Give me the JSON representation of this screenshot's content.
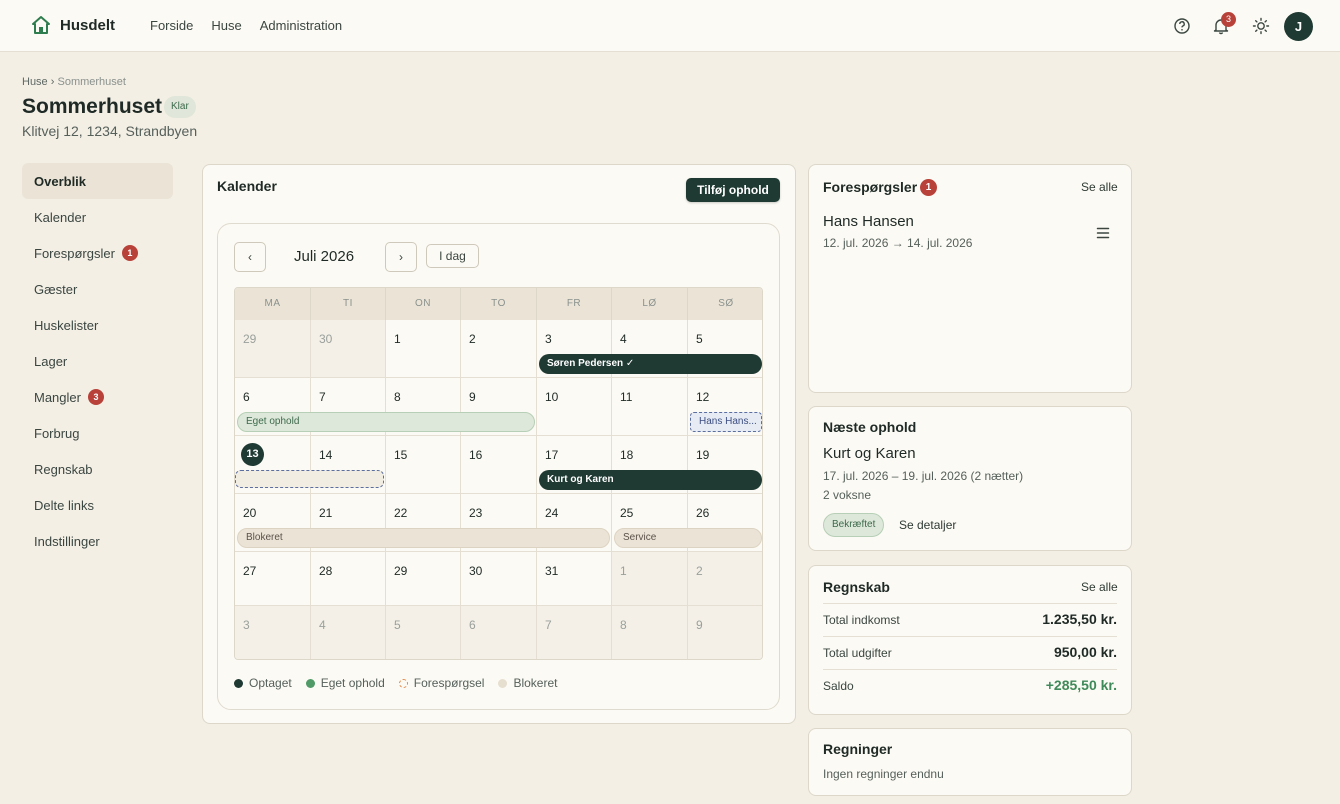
{
  "app": {
    "name": "Husdelt"
  },
  "nav": {
    "items": [
      "Forside",
      "Huse",
      "Administration"
    ]
  },
  "top": {
    "notifications_count": "3",
    "avatar_initial": "J"
  },
  "breadcrumb": {
    "parent": "Huse",
    "sep": "›",
    "current": "Sommerhuset"
  },
  "house": {
    "title": "Sommerhuset",
    "status": "Klar",
    "address": "Klitvej 12, 1234, Strandbyen"
  },
  "sidebar": {
    "items": [
      {
        "label": "Overblik",
        "badge": ""
      },
      {
        "label": "Kalender",
        "badge": ""
      },
      {
        "label": "Forespørgsler",
        "badge": "1"
      },
      {
        "label": "Gæster",
        "badge": ""
      },
      {
        "label": "Huskelister",
        "badge": ""
      },
      {
        "label": "Lager",
        "badge": ""
      },
      {
        "label": "Mangler",
        "badge": "3"
      },
      {
        "label": "Forbrug",
        "badge": ""
      },
      {
        "label": "Regnskab",
        "badge": ""
      },
      {
        "label": "Delte links",
        "badge": ""
      },
      {
        "label": "Indstillinger",
        "badge": ""
      }
    ]
  },
  "calendar": {
    "title": "Kalender",
    "add_label": "Tilføj ophold",
    "month_label": "Juli 2026",
    "prev": "‹",
    "next": "›",
    "today_label": "I dag",
    "weekdays": [
      "MA",
      "TI",
      "ON",
      "TO",
      "FR",
      "LØ",
      "SØ"
    ],
    "weeks": [
      [
        "29",
        "30",
        "1",
        "2",
        "3",
        "4",
        "5"
      ],
      [
        "6",
        "7",
        "8",
        "9",
        "10",
        "11",
        "12"
      ],
      [
        "13",
        "14",
        "15",
        "16",
        "17",
        "18",
        "19"
      ],
      [
        "20",
        "21",
        "22",
        "23",
        "24",
        "25",
        "26"
      ],
      [
        "27",
        "28",
        "29",
        "30",
        "31",
        "1",
        "2"
      ],
      [
        "3",
        "4",
        "5",
        "6",
        "7",
        "8",
        "9"
      ]
    ],
    "outside": [
      [
        0,
        0
      ],
      [
        0,
        1
      ],
      [
        4,
        5
      ],
      [
        4,
        6
      ],
      [
        5,
        0
      ],
      [
        5,
        1
      ],
      [
        5,
        2
      ],
      [
        5,
        3
      ],
      [
        5,
        4
      ],
      [
        5,
        5
      ],
      [
        5,
        6
      ]
    ],
    "today": [
      2,
      0
    ],
    "events": [
      {
        "label": "Søren Pedersen ✓",
        "type": "busy",
        "week": 0,
        "start": 4,
        "end": 6
      },
      {
        "label": "Eget ophold",
        "type": "own",
        "week": 1,
        "start": 0,
        "end": 3
      },
      {
        "label": "Hans Hans...",
        "type": "req",
        "week": 1,
        "start": 6,
        "end": 6
      },
      {
        "label": "",
        "type": "req-empty",
        "week": 2,
        "start": 0,
        "end": 1
      },
      {
        "label": "Kurt og Karen",
        "type": "busy",
        "week": 2,
        "start": 4,
        "end": 6
      },
      {
        "label": "Blokeret",
        "type": "blocked",
        "week": 3,
        "start": 0,
        "end": 4
      },
      {
        "label": "Service",
        "type": "blocked",
        "week": 3,
        "start": 5,
        "end": 6
      }
    ],
    "legend": [
      {
        "label": "Optaget",
        "color": "#1f3a33"
      },
      {
        "label": "Eget ophold",
        "color": "#4f9a67"
      },
      {
        "label": "Forespørgsel",
        "color": "#e08a4a"
      },
      {
        "label": "Blokeret",
        "color": "#e6dfcf"
      }
    ]
  },
  "requests": {
    "title": "Forespørgsler",
    "count": "1",
    "see_all": "Se alle",
    "item": {
      "name": "Hans Hansen",
      "dates": "12. jul. 2026 → 14. jul. 2026"
    }
  },
  "next_stay": {
    "title": "Næste ophold",
    "name": "Kurt og Karen",
    "dates": "17. jul. 2026 – 19. jul. 2026 (2 nætter)",
    "guests": "2 voksne",
    "status": "Bekræftet",
    "details": "Se detaljer"
  },
  "accounting": {
    "title": "Regnskab",
    "see_all": "Se alle",
    "rows": [
      {
        "label": "Total indkomst",
        "value": "1.235,50 kr."
      },
      {
        "label": "Total udgifter",
        "value": "950,00 kr."
      },
      {
        "label": "Saldo",
        "value": "+285,50 kr."
      }
    ]
  },
  "bills": {
    "title": "Regninger",
    "empty": "Ingen regninger endnu"
  }
}
